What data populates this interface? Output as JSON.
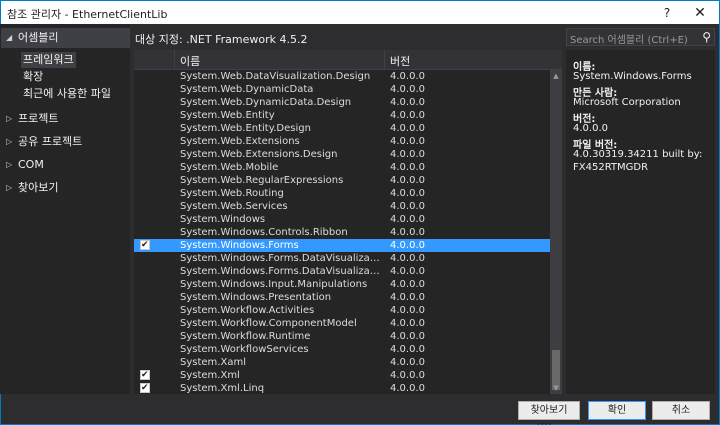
{
  "window": {
    "title": "참조 관리자 - EthernetClientLib",
    "help": "?",
    "close": "✕"
  },
  "sidebar": {
    "assemblies": "어셈블리",
    "sub": [
      "프레임워크",
      "확장",
      "최근에 사용한 파일"
    ],
    "groups": [
      "프로젝트",
      "공유 프로젝트",
      "COM",
      "찾아보기"
    ]
  },
  "target": {
    "label": "대상 지정: .NET Framework 4.5.2"
  },
  "table": {
    "header_name": "이름",
    "header_version": "버전",
    "rows": [
      {
        "name": "System.Web.DataVisualization.Design",
        "version": "4.0.0.0",
        "checked": false,
        "selected": false
      },
      {
        "name": "System.Web.DynamicData",
        "version": "4.0.0.0",
        "checked": false,
        "selected": false
      },
      {
        "name": "System.Web.DynamicData.Design",
        "version": "4.0.0.0",
        "checked": false,
        "selected": false
      },
      {
        "name": "System.Web.Entity",
        "version": "4.0.0.0",
        "checked": false,
        "selected": false
      },
      {
        "name": "System.Web.Entity.Design",
        "version": "4.0.0.0",
        "checked": false,
        "selected": false
      },
      {
        "name": "System.Web.Extensions",
        "version": "4.0.0.0",
        "checked": false,
        "selected": false
      },
      {
        "name": "System.Web.Extensions.Design",
        "version": "4.0.0.0",
        "checked": false,
        "selected": false
      },
      {
        "name": "System.Web.Mobile",
        "version": "4.0.0.0",
        "checked": false,
        "selected": false
      },
      {
        "name": "System.Web.RegularExpressions",
        "version": "4.0.0.0",
        "checked": false,
        "selected": false
      },
      {
        "name": "System.Web.Routing",
        "version": "4.0.0.0",
        "checked": false,
        "selected": false
      },
      {
        "name": "System.Web.Services",
        "version": "4.0.0.0",
        "checked": false,
        "selected": false
      },
      {
        "name": "System.Windows",
        "version": "4.0.0.0",
        "checked": false,
        "selected": false
      },
      {
        "name": "System.Windows.Controls.Ribbon",
        "version": "4.0.0.0",
        "checked": false,
        "selected": false
      },
      {
        "name": "System.Windows.Forms",
        "version": "4.0.0.0",
        "checked": true,
        "selected": true
      },
      {
        "name": "System.Windows.Forms.DataVisualization",
        "version": "4.0.0.0",
        "checked": false,
        "selected": false
      },
      {
        "name": "System.Windows.Forms.DataVisualization.Desi...",
        "version": "4.0.0.0",
        "checked": false,
        "selected": false
      },
      {
        "name": "System.Windows.Input.Manipulations",
        "version": "4.0.0.0",
        "checked": false,
        "selected": false
      },
      {
        "name": "System.Windows.Presentation",
        "version": "4.0.0.0",
        "checked": false,
        "selected": false
      },
      {
        "name": "System.Workflow.Activities",
        "version": "4.0.0.0",
        "checked": false,
        "selected": false
      },
      {
        "name": "System.Workflow.ComponentModel",
        "version": "4.0.0.0",
        "checked": false,
        "selected": false
      },
      {
        "name": "System.Workflow.Runtime",
        "version": "4.0.0.0",
        "checked": false,
        "selected": false
      },
      {
        "name": "System.WorkflowServices",
        "version": "4.0.0.0",
        "checked": false,
        "selected": false
      },
      {
        "name": "System.Xaml",
        "version": "4.0.0.0",
        "checked": false,
        "selected": false
      },
      {
        "name": "System.Xml",
        "version": "4.0.0.0",
        "checked": true,
        "selected": false
      },
      {
        "name": "System.Xml.Linq",
        "version": "4.0.0.0",
        "checked": true,
        "selected": false
      }
    ]
  },
  "search": {
    "placeholder": "Search 어셈블리 (Ctrl+E)"
  },
  "details": {
    "name_label": "이름:",
    "name_value": "System.Windows.Forms",
    "author_label": "만든 사람:",
    "author_value": "Microsoft Corporation",
    "version_label": "버전:",
    "version_value": "4.0.0.0",
    "file_version_label": "파일 버전:",
    "file_version_value_1": "4.0.30319.34211 built by:",
    "file_version_value_2": "FX452RTMGDR"
  },
  "buttons": {
    "browse": "찾아보기(B)...",
    "ok": "확인",
    "cancel": "취소"
  }
}
